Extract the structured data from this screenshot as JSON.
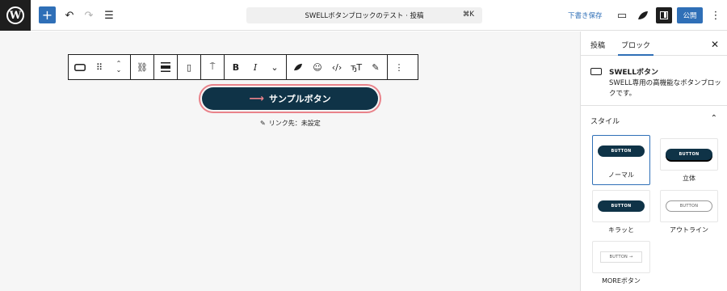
{
  "topbar": {
    "add_label": "+",
    "doc_title": "SWELLボタンブロックのテスト · 投稿",
    "shortcut": "⌘K",
    "save_draft": "下書き保存",
    "publish": "公開"
  },
  "link": {
    "label": "リンク先：未設定"
  },
  "button_block": {
    "text": "サンプルボタン"
  },
  "sidebar": {
    "tabs": [
      "投稿",
      "ブロック"
    ],
    "block_name": "SWELLボタン",
    "block_desc": "SWELL専用の高機能なボタンブロックです。",
    "style_heading": "スタイル",
    "styles": [
      {
        "label": "ノーマル",
        "preview": "BUTTON"
      },
      {
        "label": "立体",
        "preview": "BUTTON"
      },
      {
        "label": "キラッと",
        "preview": "BUTTON"
      },
      {
        "label": "アウトライン",
        "preview": "BUTTON"
      },
      {
        "label": "MOREボタン",
        "preview": "BUTTON →"
      }
    ]
  },
  "colors": {
    "accent": "#2f6fb7",
    "button_bg": "#0f3347",
    "highlight": "#e9828a"
  }
}
